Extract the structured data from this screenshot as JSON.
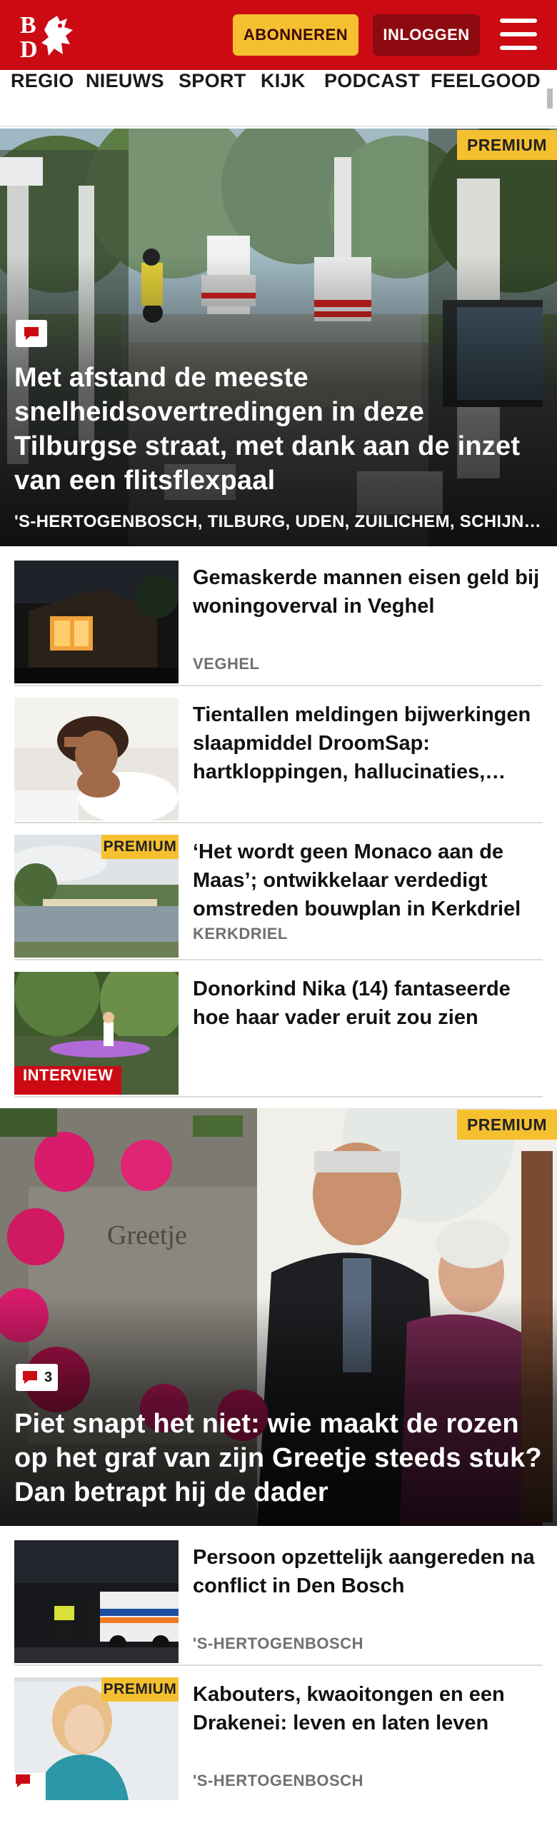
{
  "header": {
    "logo_letters": "BD",
    "subscribe_label": "ABONNEREN",
    "login_label": "INLOGGEN",
    "brand_color": "#cc0a14",
    "subscribe_color": "#f5c030"
  },
  "nav": {
    "items": [
      "REGIO",
      "NIEUWS",
      "SPORT",
      "KIJK",
      "PODCAST",
      "FEELGOOD"
    ]
  },
  "hero1": {
    "badge": "PREMIUM",
    "title": "Met afstand de meeste snelheidsovertredingen in deze Tilburgse straat, met dank aan de inzet van een flitsflexpaal",
    "locations": "'S-HERTOGENBOSCH, TILBURG, UDEN, ZUILICHEM, SCHIJNDEL",
    "comment_icon": "comment-icon"
  },
  "articles": [
    {
      "title": "Gemaskerde mannen eisen geld bij woningoverval in Veghel",
      "location": "VEGHEL"
    },
    {
      "title": "Tientallen meldingen bijwerkingen slaapmiddel DroomSap: hartkloppingen, hallucinaties,…",
      "location": ""
    },
    {
      "title": "‘Het wordt geen Monaco aan de Maas’; ontwikkelaar verdedigt omstreden bouwplan in Kerkdriel",
      "location": "KERKDRIEL",
      "badge": "PREMIUM"
    },
    {
      "title": "Donorkind Nika (14) fantaseerde hoe haar vader eruit zou zien",
      "location": "",
      "badge": "INTERVIEW"
    }
  ],
  "hero2": {
    "badge": "PREMIUM",
    "title": "Piet snapt het niet: wie maakt de rozen op het graf van zijn Greetje steeds stuk? Dan betrapt hij de dader",
    "comment_count": "3",
    "stone_text": "Greetje"
  },
  "articles2": [
    {
      "title": "Persoon opzettelijk aangereden na conflict in Den Bosch",
      "location": "'S-HERTOGENBOSCH"
    },
    {
      "title": "Kabouters, kwaoitongen en een Drakenei: leven en laten leven",
      "location": "'S-HERTOGENBOSCH",
      "badge": "PREMIUM"
    }
  ]
}
